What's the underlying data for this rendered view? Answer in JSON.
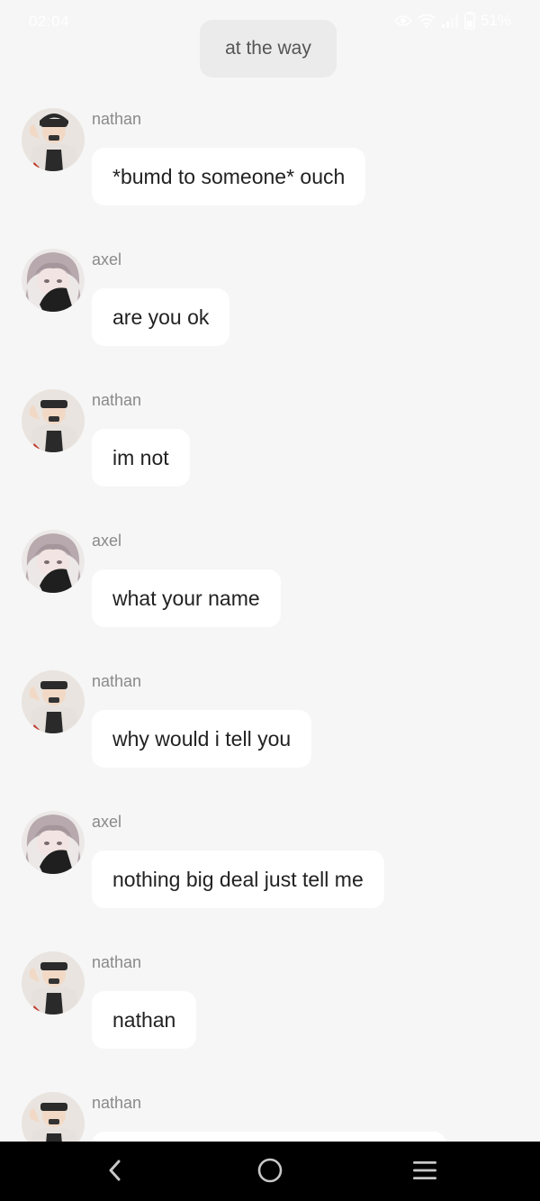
{
  "status_bar": {
    "time": "02:04",
    "battery": "51%",
    "icons": [
      "eye-comfort-icon",
      "wifi-icon",
      "signal-icon",
      "battery-icon"
    ]
  },
  "system_message": "at the way",
  "messages": [
    {
      "sender": "nathan",
      "text": "*bumd to someone* ouch",
      "avatar": "nathan-avatar"
    },
    {
      "sender": "axel",
      "text": "are you ok",
      "avatar": "axel-avatar"
    },
    {
      "sender": "nathan",
      "text": "im not",
      "avatar": "nathan-avatar"
    },
    {
      "sender": "axel",
      "text": "what your name",
      "avatar": "axel-avatar"
    },
    {
      "sender": "nathan",
      "text": "why would i tell you",
      "avatar": "nathan-avatar"
    },
    {
      "sender": "axel",
      "text": "nothing big deal just tell me",
      "avatar": "axel-avatar"
    },
    {
      "sender": "nathan",
      "text": "nathan",
      "avatar": "nathan-avatar"
    },
    {
      "sender": "nathan",
      "text": "",
      "avatar": "nathan-avatar"
    }
  ],
  "nav_bar": {
    "icons": [
      "back-icon",
      "home-icon",
      "menu-icon"
    ]
  },
  "colors": {
    "background": "#f6f6f6",
    "bubble": "#ffffff",
    "sender_name": "#8a8a8a",
    "system_pill": "#ebebeb",
    "nav_bar": "#000000"
  }
}
